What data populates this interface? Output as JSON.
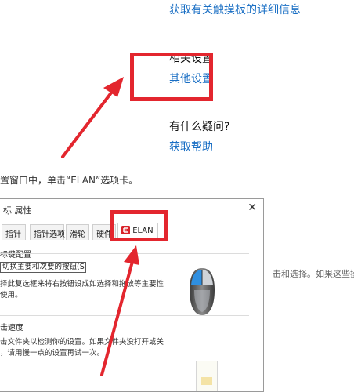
{
  "top_links": {
    "touchpad_info_link": "获取有关触摸板的详细信息",
    "related_settings_heading": "相关设置",
    "other_settings_link": "其他设置",
    "question_heading": "有什么疑问?",
    "get_help_link": "获取帮助"
  },
  "instruction": "置窗口中，单击“ELAN”选项卡。",
  "side_text": "击和选择。如果这些操",
  "dialog": {
    "title": "标 属性",
    "close": "✕",
    "tabs": [
      {
        "label": "指针"
      },
      {
        "label": "指针选项"
      },
      {
        "label": "滑轮"
      },
      {
        "label": "硬件"
      },
      {
        "label": "ELAN"
      }
    ],
    "button_config": {
      "heading": "标键配置",
      "checkbox_label": "切换主要和次要的按钮(S)",
      "desc_line1": "择此复选框来将右按钮设成如选择和拖放等主要性",
      "desc_line2": "使用。"
    },
    "double_click": {
      "heading": "击速度",
      "desc_line1": "击文件夹以检测你的设置。如果文件夹没打开或关",
      "desc_line2": "，请用慢一点的设置再试一次。"
    }
  },
  "colors": {
    "link": "#1a6fc4",
    "highlight_red": "#e3262e",
    "elan_logo_red": "#d9232a"
  }
}
